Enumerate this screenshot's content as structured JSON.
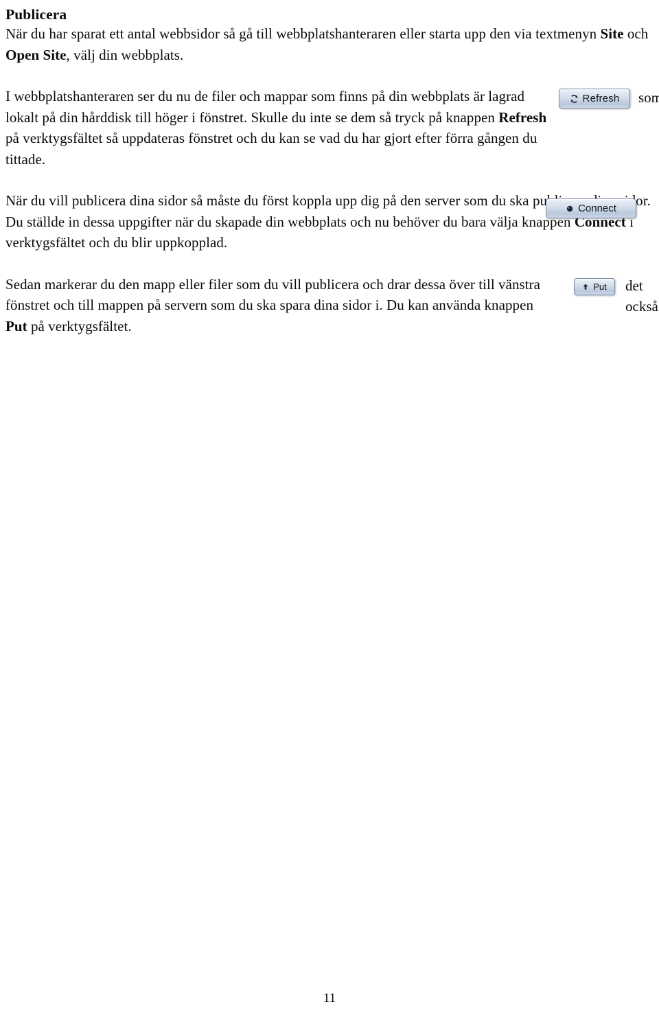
{
  "document": {
    "page_number": "11",
    "language": "sv",
    "heading": "Publicera"
  },
  "paragraphs": {
    "p1": {
      "line1_a": "När du har sparat ett antal webbsidor så gå till webbplatshanteraren eller starta upp den via textmenyn ",
      "bold1": "Site",
      "mid1": " och ",
      "bold2": "Open Site",
      "tail1": ", välj din webbplats."
    },
    "p2": {
      "part1": "I webbplatshanteraren ser du nu de filer och mappar som finns på din webbplats är lagrad lokalt på din hårddisk till höger i fönstret. Skulle du inte se dem så tryck på knappen ",
      "bold": "Refresh",
      "part2": " på verktygsfältet så uppdateras fönstret och du kan se vad du har gjort efter förra gången du tittade.",
      "side_word": "som"
    },
    "p3": {
      "part1": "När du vill publicera dina sidor så måste du först koppla upp dig på den server som du ska publicera dina sidor. Du ställde in dessa uppgifter när du skapade din webbplats och nu behöver du bara välja knappen ",
      "bold": "Connect",
      "part2": " i verktygsfältet och du blir uppkopplad."
    },
    "p4": {
      "part1": "Sedan markerar du den mapp eller filer som du vill publicera och drar dessa över till vänstra fönstret och till mappen på servern som du ska spara dina sidor i. Du kan använda knappen ",
      "bold": "Put",
      "part2": " på verktygsfältet.",
      "side_word_1": "det",
      "side_word_2": "också"
    }
  },
  "buttons": {
    "refresh": {
      "label": "Refresh",
      "icon": "refresh-icon"
    },
    "connect": {
      "label": "Connect",
      "icon": "connect-dot-icon"
    },
    "put": {
      "label": "Put",
      "icon": "up-arrow-icon"
    }
  },
  "colors": {
    "page_background": "#ffffff",
    "text": "#0b0b0b",
    "button_face": "#cfdae8",
    "button_border": "#7b8da4",
    "button_highlight": "#f3f7fb"
  }
}
